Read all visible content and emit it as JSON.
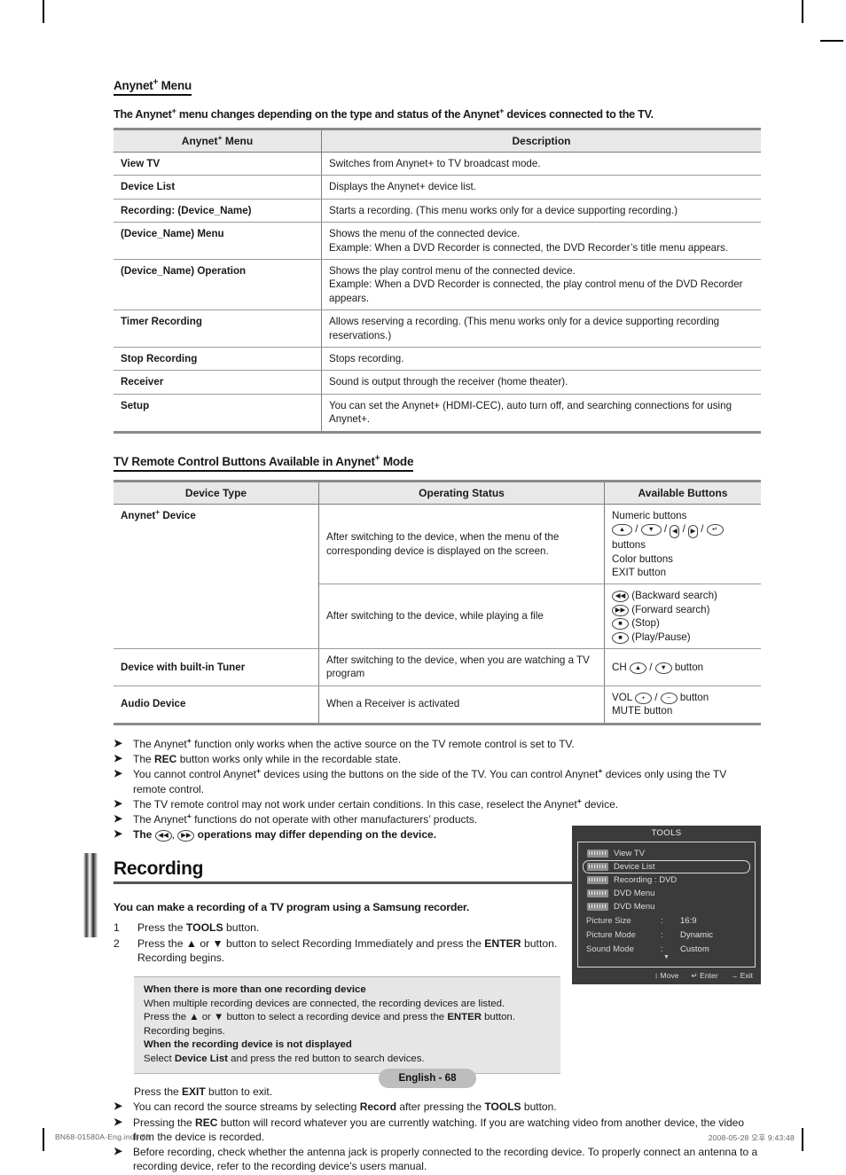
{
  "section1": {
    "heading_pre": "Anynet",
    "heading_post": " Menu",
    "intro_a": "The Anynet",
    "intro_b": " menu changes depending on the type and status of the Anynet",
    "intro_c": " devices connected to the TV.",
    "table": {
      "headers": [
        "Anynet+ Menu",
        "Description"
      ],
      "header_left_pre": "Anynet",
      "header_left_post": " Menu",
      "header_right": "Description",
      "rows": [
        {
          "label": "View TV",
          "desc": "Switches from Anynet+ to TV broadcast mode."
        },
        {
          "label": "Device List",
          "desc": "Displays the Anynet+ device list."
        },
        {
          "label": "Recording: (Device_Name)",
          "desc": "Starts a recording. (This menu works only for a device supporting recording.)"
        },
        {
          "label": "(Device_Name) Menu",
          "desc": "Shows the menu of the connected device.\nExample: When a DVD Recorder is connected, the DVD Recorder’s title menu appears."
        },
        {
          "label": "(Device_Name) Operation",
          "desc": "Shows the play control menu of the connected device.\nExample: When a DVD Recorder is connected, the play control menu of the DVD Recorder appears."
        },
        {
          "label": "Timer Recording",
          "desc": "Allows reserving a recording. (This menu works only for a device supporting recording reservations.)"
        },
        {
          "label": "Stop Recording",
          "desc": "Stops recording."
        },
        {
          "label": "Receiver",
          "desc": "Sound is output through the receiver (home theater)."
        },
        {
          "label": "Setup",
          "desc": "You can set the Anynet+ (HDMI-CEC), auto turn off, and searching connections for using Anynet+."
        }
      ]
    }
  },
  "section2": {
    "heading_pre": "TV  Remote Control Buttons Available in Anynet",
    "heading_post": " Mode",
    "table": {
      "header_device": "Device Type",
      "header_status": "Operating Status",
      "header_buttons": "Available Buttons",
      "device_anynet_pre": "Anynet",
      "device_anynet_post": " Device",
      "status_menu": "After switching to the device, when the menu of the corresponding device is displayed on the screen.",
      "buttons_menu_line1": "Numeric buttons",
      "buttons_menu_line2_suffix": " buttons",
      "buttons_menu_line3": "Color buttons",
      "buttons_menu_line4": "EXIT button",
      "status_playing": "After switching to the device, while playing a file",
      "buttons_play": [
        "(Backward search)",
        "(Forward search)",
        "(Stop)",
        "(Play/Pause)"
      ],
      "device_tuner": "Device with built-in Tuner",
      "status_tuner": "After switching to the device, when you are watching a TV program",
      "buttons_tuner_prefix": "CH",
      "buttons_tuner_suffix": "button",
      "device_audio": "Audio Device",
      "status_audio": "When a Receiver is activated",
      "buttons_audio_prefix": "VOL",
      "buttons_audio_suffix": "button",
      "buttons_audio_line2": "MUTE button"
    }
  },
  "notes_top": [
    {
      "parts": [
        {
          "t": "The Anynet",
          "b": false
        },
        {
          "t": "+",
          "sup": true
        },
        {
          "t": " function only works when the active source on the TV remote control is set to TV.",
          "b": false
        }
      ]
    },
    {
      "parts": [
        {
          "t": "The ",
          "b": false
        },
        {
          "t": "REC",
          "b": true
        },
        {
          "t": " button works only while in the recordable state.",
          "b": false
        }
      ]
    },
    {
      "parts": [
        {
          "t": "You cannot control Anynet",
          "b": false
        },
        {
          "t": "+",
          "sup": true
        },
        {
          "t": " devices using the buttons on the side of the TV. You can control Anynet",
          "b": false
        },
        {
          "t": "+",
          "sup": true
        },
        {
          "t": " devices only using the TV remote control.",
          "b": false
        }
      ]
    },
    {
      "parts": [
        {
          "t": "The TV remote control may not work under certain conditions. In this case, reselect the Anynet",
          "b": false
        },
        {
          "t": "+",
          "sup": true
        },
        {
          "t": " device.",
          "b": false
        }
      ]
    },
    {
      "parts": [
        {
          "t": "The Anynet",
          "b": false
        },
        {
          "t": "+",
          "sup": true
        },
        {
          "t": " functions do not operate with other manufacturers’ products.",
          "b": false
        }
      ]
    }
  ],
  "notes_top_last": {
    "lead": "The ",
    "tail": " operations may differ depending on the device."
  },
  "recording": {
    "title": "Recording",
    "lead": "You can make a recording of a TV program using a Samsung recorder.",
    "steps": [
      {
        "num": "1",
        "pre": "Press the ",
        "bold": "TOOLS",
        "post": " button."
      },
      {
        "num": "2",
        "pre": "Press the ▲ or ▼ button to select Recording Immediately and press the ",
        "bold": "ENTER",
        "post": " button. Recording begins."
      }
    ],
    "notebox": {
      "head1": "When there is more than one recording device",
      "body1a": "When multiple recording devices are connected, the recording devices are listed.",
      "body1b_pre": "Press the ▲ or ▼ button to select a recording device and press the ",
      "body1b_bold": "ENTER",
      "body1b_post": " button. Recording begins.",
      "head2": "When the recording device is not displayed",
      "body2_pre": "Select ",
      "body2_bold": "Device List",
      "body2_post": " and press the red button to search devices."
    },
    "exit_line": {
      "pre": "Press the ",
      "bold": "EXIT",
      "post": " button to exit."
    },
    "notes_bottom": [
      {
        "parts": [
          {
            "t": "You can record the source streams by selecting ",
            "b": false
          },
          {
            "t": "Record",
            "b": true
          },
          {
            "t": " after pressing the ",
            "b": false
          },
          {
            "t": "TOOLS",
            "b": true
          },
          {
            "t": " button.",
            "b": false
          }
        ]
      },
      {
        "parts": [
          {
            "t": "Pressing the ",
            "b": false
          },
          {
            "t": "REC",
            "b": true
          },
          {
            "t": " button will record whatever you are currently watching. If you are watching video from another device, the video from the device is recorded.",
            "b": false
          }
        ]
      },
      {
        "parts": [
          {
            "t": "Before recording, check whether the antenna jack is properly connected to the recording device. To properly connect an antenna to a recording device, refer to the recording device’s users manual.",
            "b": false
          }
        ]
      }
    ]
  },
  "osd": {
    "title": "TOOLS",
    "items": [
      {
        "label": "View TV",
        "badge": true,
        "selected": false
      },
      {
        "label": "Device List",
        "badge": true,
        "selected": true
      },
      {
        "label": "Recording : DVD",
        "badge": true,
        "selected": false
      },
      {
        "label": "DVD Menu",
        "badge": true,
        "selected": false
      },
      {
        "label": "DVD Menu",
        "badge": true,
        "selected": false
      }
    ],
    "settings": [
      {
        "key": "Picture Size",
        "sep": ":",
        "value": "16:9"
      },
      {
        "key": "Picture Mode",
        "sep": ":",
        "value": "Dynamic"
      },
      {
        "key": "Sound Mode",
        "sep": ":",
        "value": "Custom"
      }
    ],
    "scroll_down": "▼",
    "footer": [
      {
        "icon": "↕",
        "label": "Move"
      },
      {
        "icon": "↵",
        "label": "Enter"
      },
      {
        "icon": "→",
        "label": "Exit"
      }
    ]
  },
  "page_number": "English - 68",
  "footer_left": "BN68-01580A-Eng.indb   68",
  "footer_right": "2008-05-28   오후 9:43:48"
}
